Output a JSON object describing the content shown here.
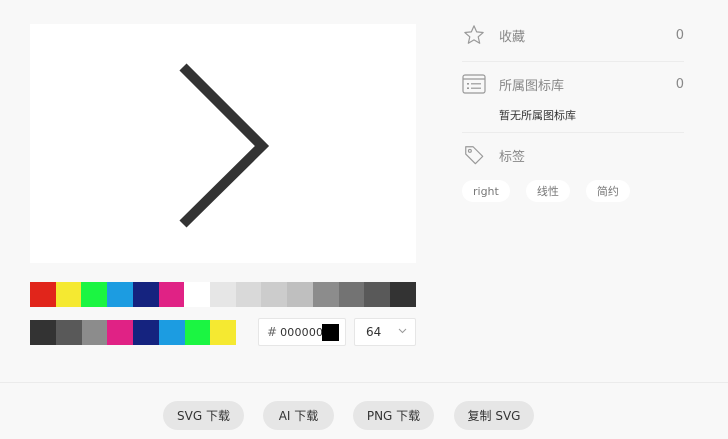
{
  "preview": {
    "icon_name": "chevron-right-icon",
    "icon_color": "#333333",
    "background": "#ffffff"
  },
  "palette": {
    "row1": [
      "#e1251b",
      "#f5e931",
      "#1bf542",
      "#1c9ce1",
      "#15237f",
      "#e02285",
      "#ffffff",
      "#e6e6e6",
      "#d9d9d9",
      "#cccccc",
      "#bfbfbf",
      "#8c8c8c",
      "#737373",
      "#595959",
      "#333333"
    ],
    "row2": [
      "#333333",
      "#595959",
      "#8c8c8c",
      "#e02285",
      "#15237f",
      "#1c9ce1",
      "#1bf542",
      "#f5e931"
    ]
  },
  "color_input": {
    "hash": "#",
    "value": "000000",
    "preview_color": "#000000"
  },
  "size_select": {
    "value": "64"
  },
  "info": {
    "favorites": {
      "label": "收藏",
      "count": "0"
    },
    "libraries": {
      "label": "所属图标库",
      "count": "0",
      "empty_text": "暂无所属图标库"
    },
    "tags": {
      "label": "标签",
      "items": [
        "right",
        "线性",
        "简约"
      ]
    }
  },
  "actions": {
    "svg_download": "SVG 下载",
    "ai_download": "AI 下载",
    "png_download": "PNG 下载",
    "copy_svg": "复制 SVG"
  }
}
